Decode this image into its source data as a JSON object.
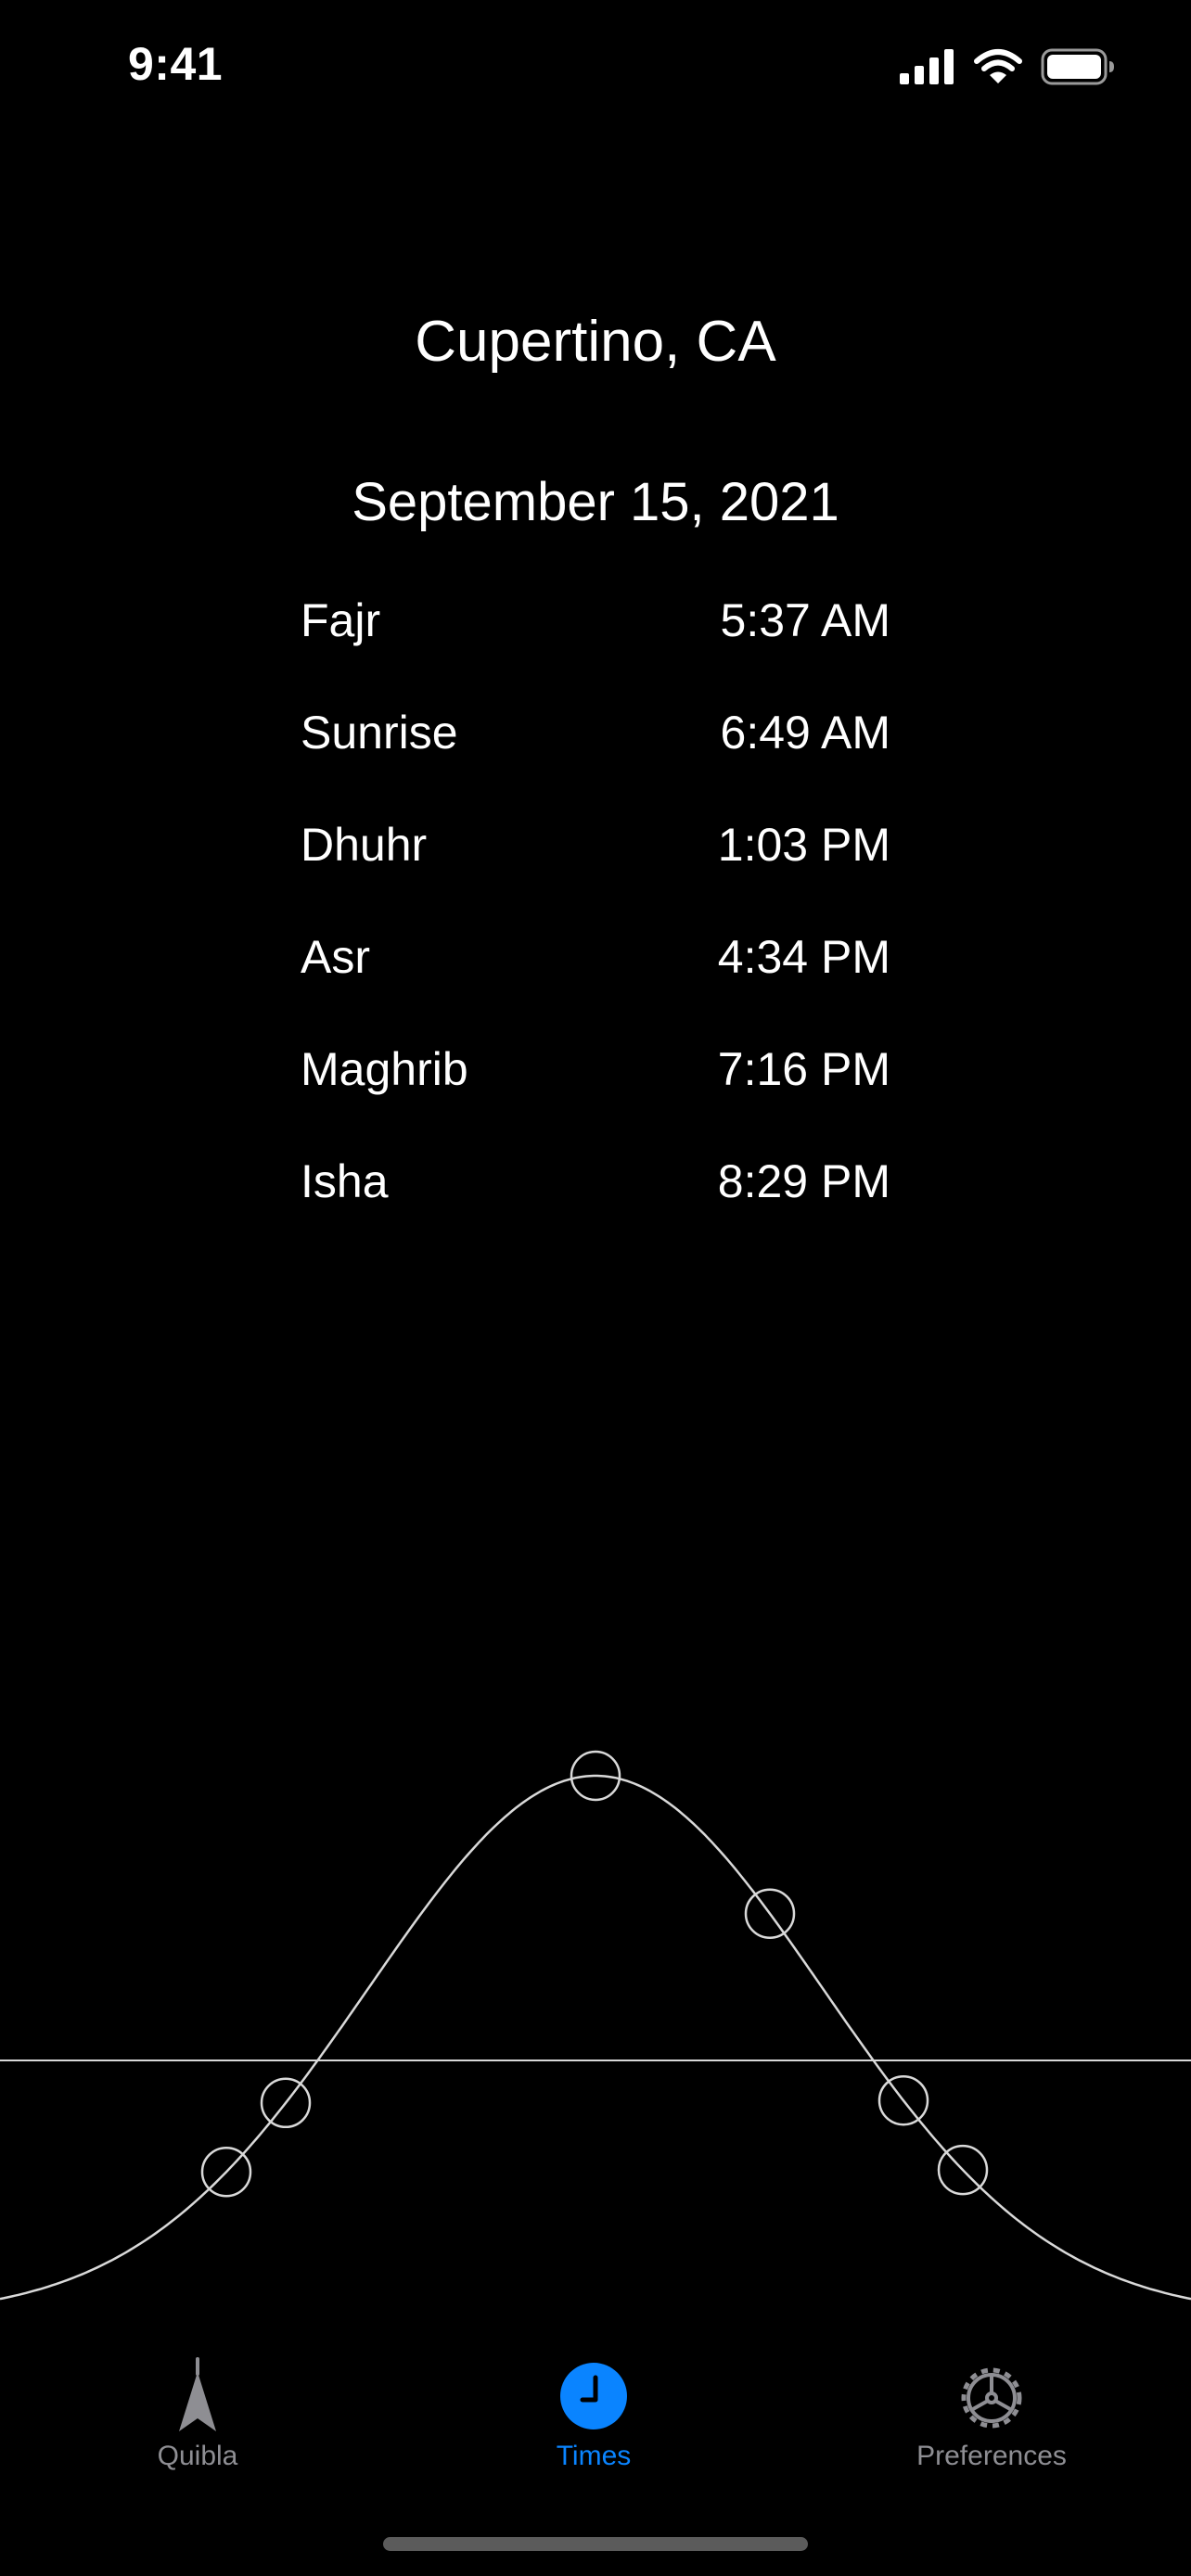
{
  "status_bar": {
    "time": "9:41"
  },
  "location": "Cupertino, CA",
  "date": "September 15, 2021",
  "prayers": [
    {
      "name": "Fajr",
      "time": "5:37 AM"
    },
    {
      "name": "Sunrise",
      "time": "6:49 AM"
    },
    {
      "name": "Dhuhr",
      "time": "1:03 PM"
    },
    {
      "name": "Asr",
      "time": "4:34 PM"
    },
    {
      "name": "Maghrib",
      "time": "7:16 PM"
    },
    {
      "name": "Isha",
      "time": "8:29 PM"
    }
  ],
  "tab_bar": {
    "items": [
      {
        "label": "Quibla",
        "icon": "compass-arrow-icon",
        "selected": false
      },
      {
        "label": "Times",
        "icon": "clock-icon",
        "selected": true
      },
      {
        "label": "Preferences",
        "icon": "gear-icon",
        "selected": false
      }
    ]
  },
  "colors": {
    "background": "#000000",
    "text": "#ffffff",
    "accent": "#0a84ff",
    "tab_inactive": "#8e8e93",
    "curve": "#d9d9d9"
  }
}
